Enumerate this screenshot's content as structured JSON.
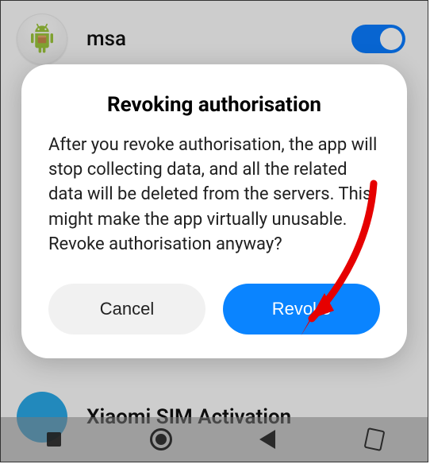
{
  "background": {
    "app_name": "msa",
    "second_app_name": "Xiaomi SIM Activation"
  },
  "dialog": {
    "title": "Revoking authorisation",
    "body": "After you revoke authorisation, the app will stop collecting data, and all the related data will be deleted from the servers. This might make the app virtually unusable. Revoke authorisation anyway?",
    "cancel_label": "Cancel",
    "revoke_label": "Revoke"
  },
  "colors": {
    "accent": "#0a84ff"
  }
}
